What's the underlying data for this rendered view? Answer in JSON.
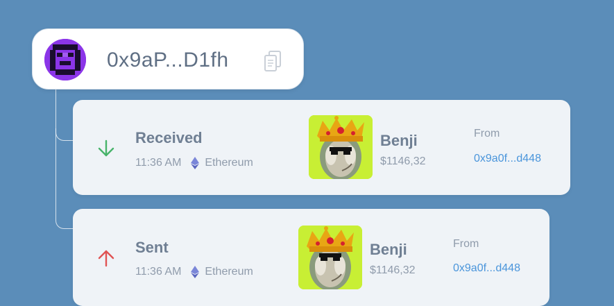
{
  "wallet": {
    "address": "0x9aP...D1fh",
    "copy_icon": "copy-icon",
    "avatar_icon": "pixel-avatar-icon"
  },
  "transactions": [
    {
      "direction": "Received",
      "direction_icon": "arrow-down-icon",
      "direction_color": "#47b36a",
      "time": "11:36 AM",
      "network": "Ethereum",
      "network_icon": "ethereum-icon",
      "nft_name": "Benji",
      "nft_price": "$1146,32",
      "from_label": "From",
      "from_address": "0x9a0f...d448"
    },
    {
      "direction": "Sent",
      "direction_icon": "arrow-up-icon",
      "direction_color": "#e05353",
      "time": "11:36 AM",
      "network": "Ethereum",
      "network_icon": "ethereum-icon",
      "nft_name": "Benji",
      "nft_price": "$1146,32",
      "from_label": "From",
      "from_address": "0x9a0f...d448"
    }
  ],
  "colors": {
    "background": "#5b8db9",
    "card": "#eff3f7",
    "nft_background": "#c8ef34",
    "link": "#4a95db"
  }
}
